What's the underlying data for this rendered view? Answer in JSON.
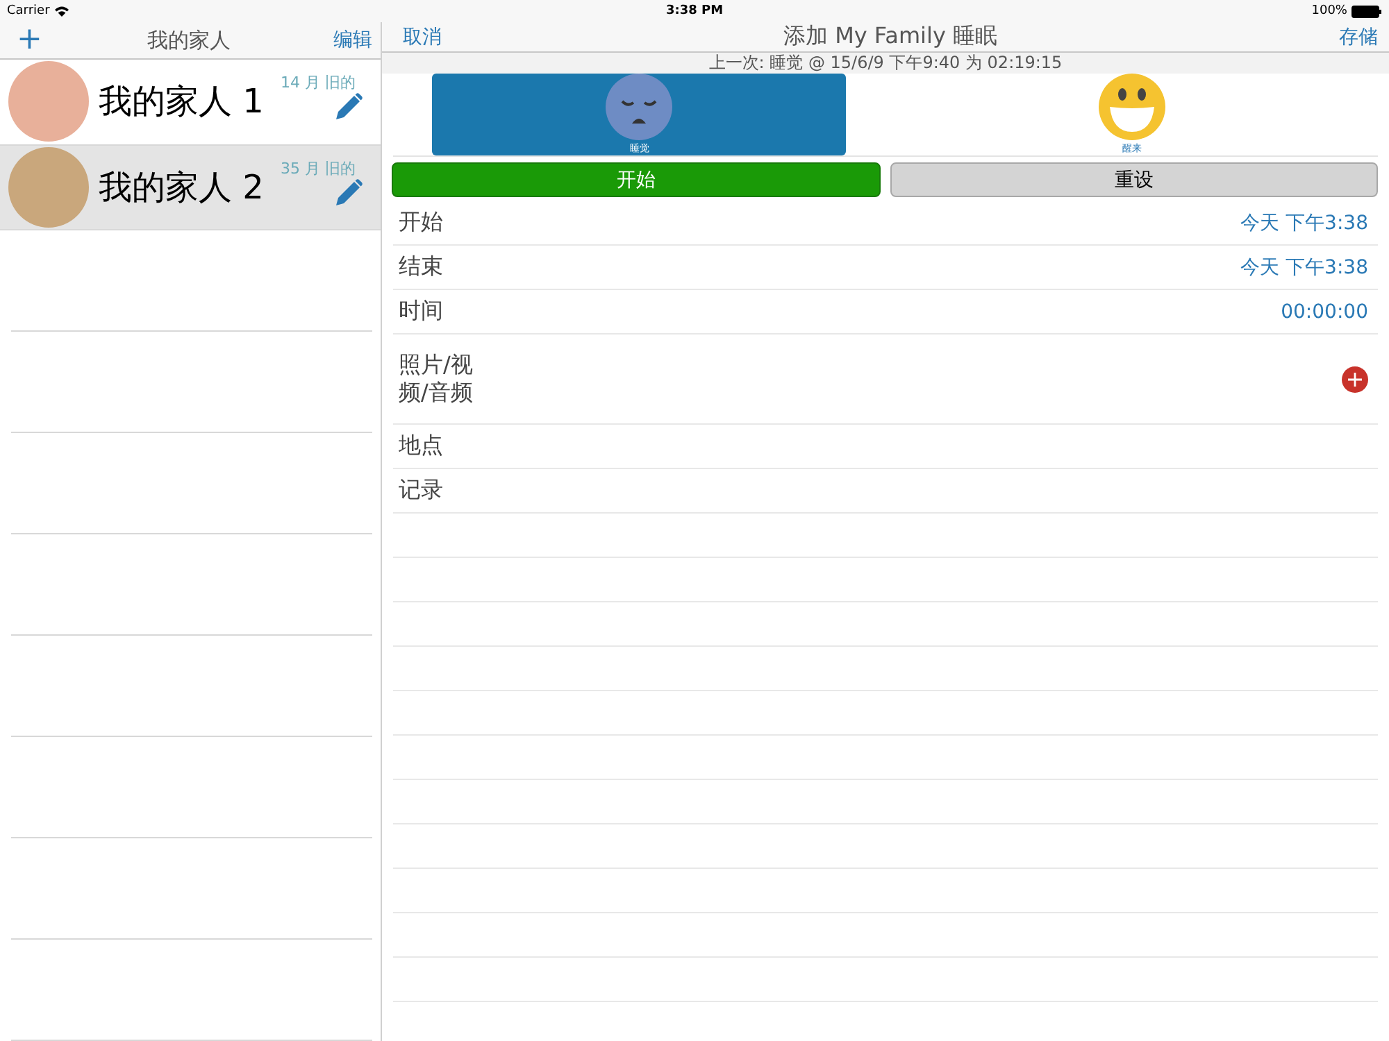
{
  "status_bar": {
    "carrier": "Carrier",
    "time": "3:38 PM",
    "battery": "100%"
  },
  "family_pane": {
    "add_button": "+",
    "title": "我的家人",
    "edit_button": "编辑",
    "members": [
      {
        "name": "我的家人 1",
        "age": "14 月 旧的",
        "selected": false
      },
      {
        "name": "我的家人 2",
        "age": "35 月 旧的",
        "selected": true
      }
    ]
  },
  "sleep_form": {
    "cancel_button": "取消",
    "title": "添加 My Family 睡眠",
    "save_button": "存储",
    "last_entry": "上一次: 睡觉 @ 15/6/9 下午9:40 为 02:19:15",
    "modes": [
      {
        "kind": "sleep",
        "label": "睡觉",
        "selected": true
      },
      {
        "kind": "awake",
        "label": "醒来",
        "selected": false
      }
    ],
    "buttons": [
      {
        "kind": "start",
        "label": "开始"
      },
      {
        "kind": "reset",
        "label": "重设"
      }
    ],
    "fields": [
      {
        "kind": "value",
        "label": "开始",
        "value": "今天 下午3:38"
      },
      {
        "kind": "value",
        "label": "结束",
        "value": "今天 下午3:38"
      },
      {
        "kind": "value",
        "label": "时间",
        "value": "00:00:00"
      },
      {
        "kind": "media",
        "label": "照片/视频/音频"
      },
      {
        "kind": "plain",
        "label": "地点"
      },
      {
        "kind": "plain",
        "label": "记录"
      }
    ]
  }
}
